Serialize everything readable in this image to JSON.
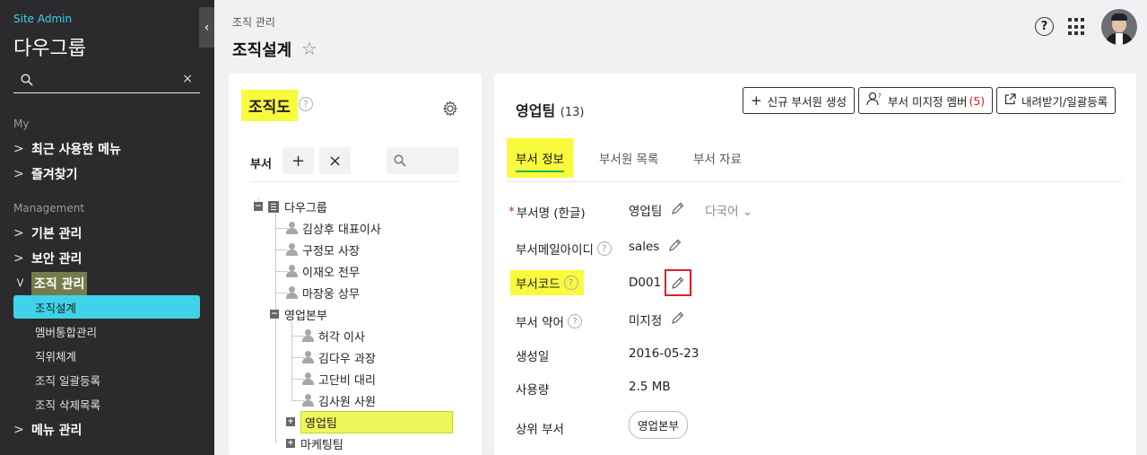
{
  "sidebar": {
    "site_label": "Site Admin",
    "org_name": "다우그룹",
    "search_clear": "×",
    "collapse_glyph": "‹",
    "section_my": "My",
    "section_mgmt": "Management",
    "my_items": [
      "최근 사용한 메뉴",
      "즐겨찾기"
    ],
    "mgmt_items": [
      "기본 관리",
      "보안 관리",
      "조직 관리"
    ],
    "sub_items": [
      "조직설계",
      "멤버통합관리",
      "직위체계",
      "조직 일괄등록",
      "조직 삭제목록"
    ],
    "menu_mgmt": "메뉴 관리"
  },
  "header": {
    "breadcrumb": "조직 관리",
    "title": "조직설계",
    "help": "?"
  },
  "org_panel": {
    "title": "조직도",
    "toolbar_label": "부서",
    "add": "+",
    "remove": "×",
    "tree": [
      "다우그룹",
      "김상후 대표이사",
      "구정모 사장",
      "이재오 전무",
      "마장웅 상무",
      "영업본부",
      "허각 이사",
      "김다우 과장",
      "고단비 대리",
      "김사원 사원",
      "영업팀",
      "마케팅팀"
    ]
  },
  "detail": {
    "dept_name": "영업팀",
    "dept_count": "(13)",
    "buttons": {
      "new_member": "신규 부서원 생성",
      "unassigned": "부서 미지정 멤버",
      "unassigned_count": "(5)",
      "download": "내려받기/일괄등록"
    },
    "tabs": [
      "부서 정보",
      "부서원 목록",
      "부서 자료"
    ],
    "fields": {
      "name_label": "부서명 (한글)",
      "name_required": "*",
      "name_value": "영업팀",
      "multilang": "다국어",
      "email_label": "부서메일아이디",
      "email_value": "sales",
      "code_label": "부서코드",
      "code_value": "D001",
      "abbr_label": "부서 약어",
      "abbr_value": "미지정",
      "created_label": "생성일",
      "created_value": "2016-05-23",
      "usage_label": "사용량",
      "usage_value": "2.5 MB",
      "parent_label": "상위 부서",
      "parent_value": "영업본부"
    }
  },
  "colors": {
    "sidebar_bg": "#2b2b2d",
    "accent_cyan": "#3ed3e8",
    "highlight_yellow": "#fafa3c",
    "alert_red": "#e0202a"
  }
}
